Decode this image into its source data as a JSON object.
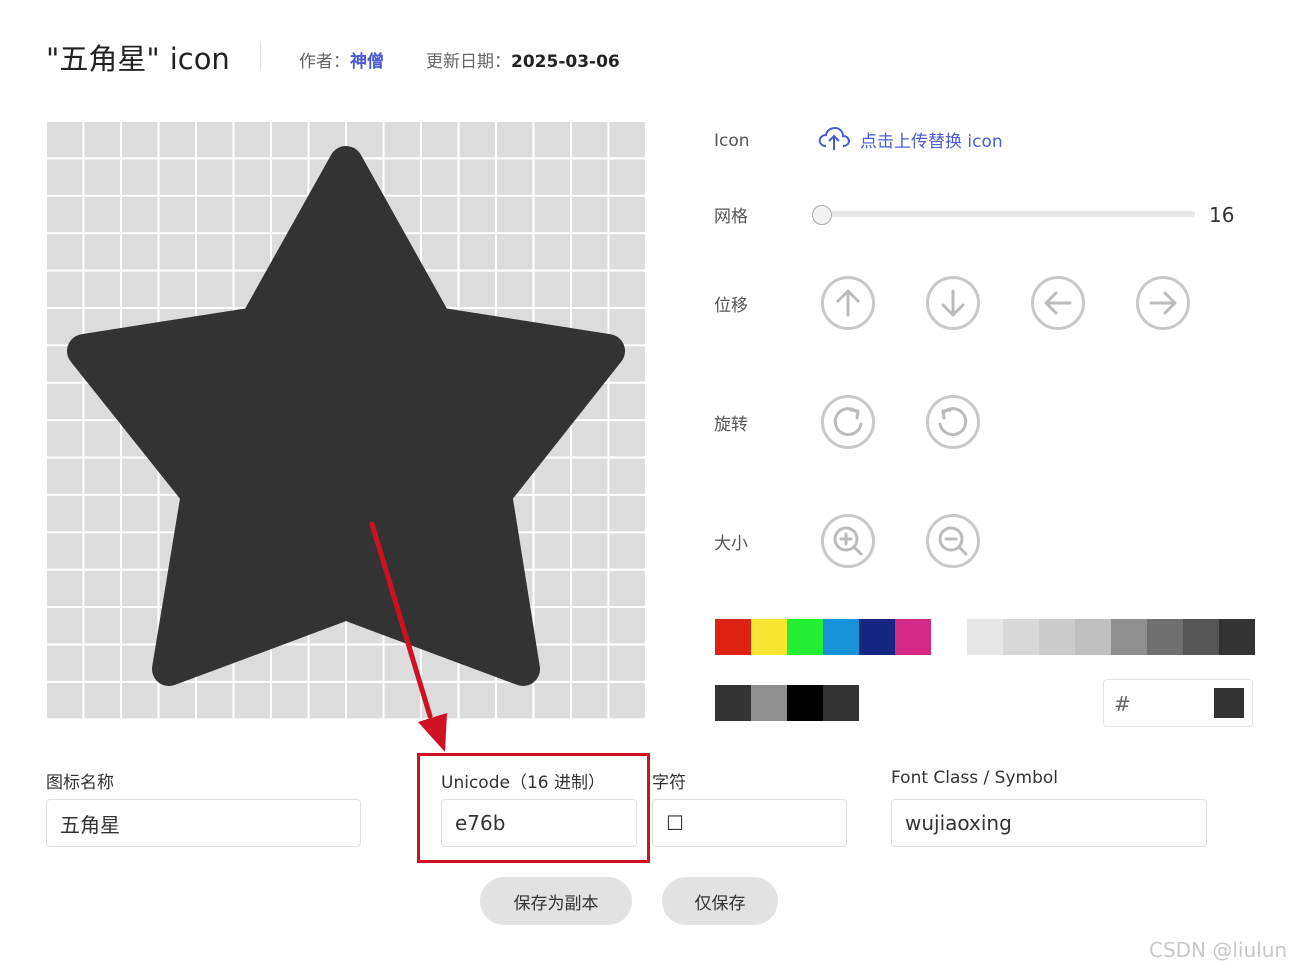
{
  "header": {
    "title": "\"五角星\"",
    "title_suffix": "icon",
    "author_label": "作者：",
    "author_name": "神僧",
    "date_label": "更新日期：",
    "date_value": "2025-03-06"
  },
  "controls": {
    "icon_label": "Icon",
    "upload_text": "点击上传替换 icon",
    "grid_label": "网格",
    "grid_value": "16",
    "grid_slider_fraction": 0.0,
    "move_label": "位移",
    "rotate_label": "旋转",
    "size_label": "大小",
    "move_icons": [
      "arrow-up-icon",
      "arrow-down-icon",
      "arrow-left-icon",
      "arrow-right-icon"
    ],
    "rotate_icons": [
      "rotate-clockwise-icon",
      "rotate-counterclockwise-icon"
    ],
    "size_icons": [
      "zoom-in-icon",
      "zoom-out-icon"
    ]
  },
  "colors": {
    "icon_fill": "#333333",
    "accent": "#4b5bd6",
    "highlight": "#cf1124",
    "palette": [
      "#dd2211",
      "#f5e62f",
      "#22ee33",
      "#1592d8",
      "#142582",
      "#d42a86"
    ],
    "grays": [
      "#e6e6e6",
      "#d8d8d8",
      "#cccccc",
      "#bfbfbf",
      "#8f8f8f",
      "#707070",
      "#555555",
      "#333333"
    ],
    "recent": [
      "#333333",
      "#8f8f8f",
      "#000000",
      "#333333"
    ],
    "hash_symbol": "#",
    "hex_value": ""
  },
  "form": {
    "name_label": "图标名称",
    "name_value": "五角星",
    "unicode_label": "Unicode（16 进制）",
    "unicode_value": "e76b",
    "char_label": "字符",
    "char_value": "☐",
    "fontclass_label": "Font Class / Symbol",
    "fontclass_value": "wujiaoxing"
  },
  "buttons": {
    "save_copy": "保存为副本",
    "save_only": "仅保存"
  },
  "watermark": "CSDN @liulun"
}
